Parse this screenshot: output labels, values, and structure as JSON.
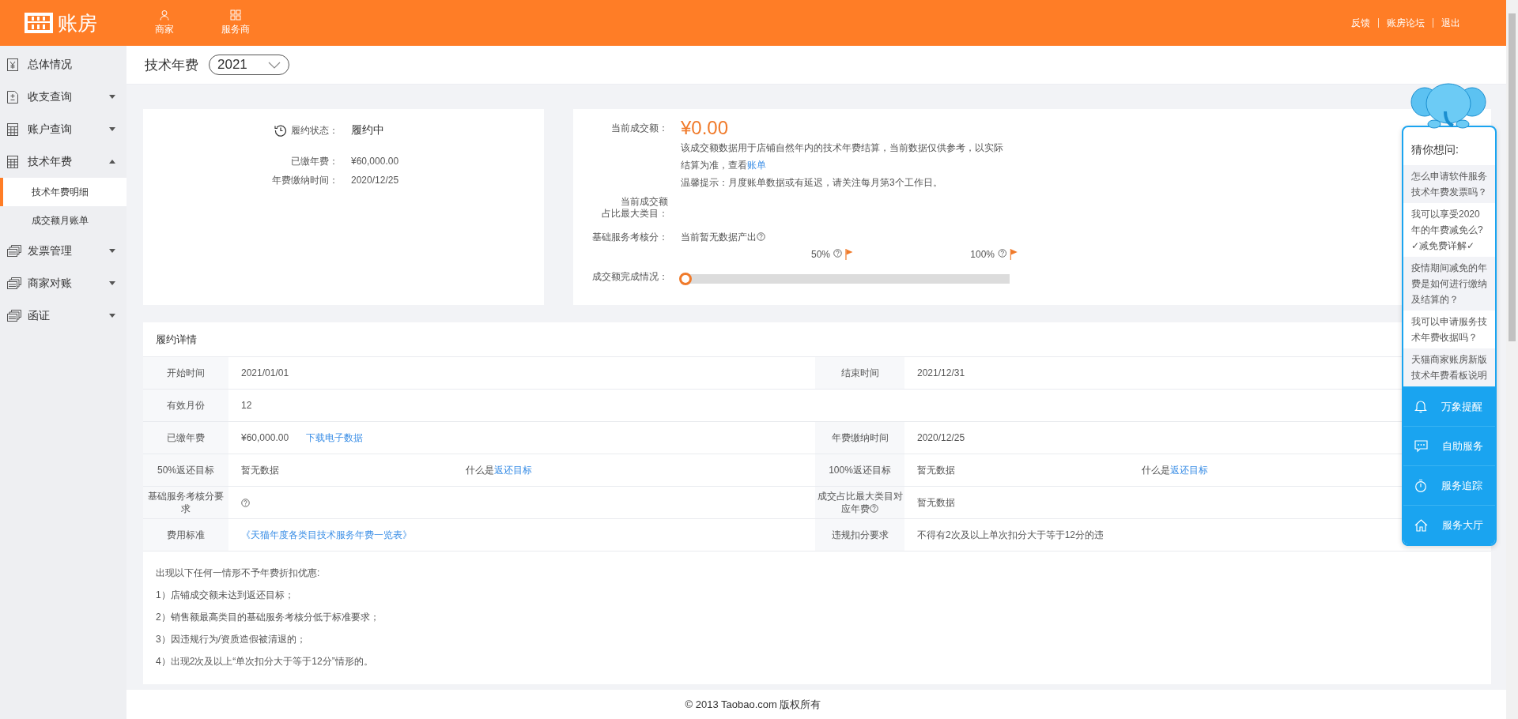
{
  "header": {
    "logo": "账房",
    "nav": [
      {
        "label": "商家"
      },
      {
        "label": "服务商"
      }
    ],
    "links": [
      "反馈",
      "账房论坛",
      "退出"
    ]
  },
  "sidebar": {
    "items": [
      {
        "label": "总体情况",
        "kind": "link"
      },
      {
        "label": "收支查询",
        "kind": "group",
        "expanded": false
      },
      {
        "label": "账户查询",
        "kind": "group",
        "expanded": false
      },
      {
        "label": "技术年费",
        "kind": "group",
        "expanded": true,
        "children": [
          {
            "label": "技术年费明细",
            "selected": true
          },
          {
            "label": "成交额月账单",
            "selected": false
          }
        ]
      },
      {
        "label": "发票管理",
        "kind": "group",
        "expanded": false
      },
      {
        "label": "商家对账",
        "kind": "group",
        "expanded": false
      },
      {
        "label": "函证",
        "kind": "group",
        "expanded": false
      }
    ]
  },
  "page": {
    "title": "技术年费",
    "year": "2021"
  },
  "status": {
    "label": "履约状态：",
    "value": "履约中",
    "rows": [
      {
        "label": "已缴年费：",
        "value": "¥60,000.00"
      },
      {
        "label": "年费缴纳时间：",
        "value": "2020/12/25"
      }
    ]
  },
  "sales": {
    "amount_label": "当前成交额：",
    "amount": "¥0.00",
    "note": "该成交额数据用于店铺自然年内的技术年费结算，当前数据仅供参考，以实际结算为准，查看",
    "note_link": "账单",
    "tip": "温馨提示：月度账单数据或有延迟，请关注每月第3个工作日。",
    "category_label": [
      "当前成交额",
      "占比最大类目："
    ],
    "score_label": "基础服务考核分：",
    "score_value": "当前暂无数据产出",
    "progress_label": "成交额完成情况：",
    "level": 0,
    "marks": [
      "50%",
      "100%"
    ]
  },
  "detail": {
    "title": "履约详情",
    "rows": [
      {
        "cells": [
          {
            "kind": "label",
            "text": "开始时间"
          },
          {
            "kind": "value",
            "text": "2021/01/01"
          },
          {
            "kind": "label",
            "text": "结束时间"
          },
          {
            "kind": "value",
            "text": "2021/12/31"
          }
        ]
      },
      {
        "cells": [
          {
            "kind": "label",
            "text": "有效月份"
          },
          {
            "kind": "value",
            "text": "12"
          }
        ]
      },
      {
        "cells": [
          {
            "kind": "label",
            "text": "已缴年费"
          },
          {
            "kind": "value",
            "text": "¥60,000.00",
            "link": "下载电子数据"
          },
          {
            "kind": "label",
            "text": "年费缴纳时间"
          },
          {
            "kind": "value",
            "text": "2020/12/25"
          }
        ]
      },
      {
        "cells": [
          {
            "kind": "label",
            "text": "50%返还目标"
          },
          {
            "kind": "value",
            "text": "暂无数据",
            "hint": "什么是",
            "hint_link": "返还目标"
          },
          {
            "kind": "label",
            "text": "100%返还目标"
          },
          {
            "kind": "value",
            "text": "暂无数据",
            "hint": "什么是",
            "hint_link": "返还目标"
          }
        ]
      },
      {
        "cells": [
          {
            "kind": "label",
            "text": "基础服务考核分要求"
          },
          {
            "kind": "help"
          },
          {
            "kind": "label_help",
            "text": "成交占比最大类目对应年费"
          },
          {
            "kind": "value",
            "text": "暂无数据"
          }
        ]
      },
      {
        "cells": [
          {
            "kind": "label",
            "text": "费用标准"
          },
          {
            "kind": "link",
            "text": "《天猫年度各类目技术服务年费一览表》"
          },
          {
            "kind": "label",
            "text": "违规扣分要求"
          },
          {
            "kind": "value",
            "text": "不得有2次及以上单次扣分大于等于12分的违"
          }
        ]
      }
    ],
    "notes": [
      "出现以下任何一情形不予年费折扣优惠:",
      "1）店铺成交额未达到返还目标；",
      "2）销售额最高类目的基础服务考核分低于标准要求；",
      "3）因违规行为/资质造假被清退的；",
      "4）出现2次及以上“单次扣分大于等于12分”情形的。"
    ]
  },
  "help": {
    "title": "猜你想问:",
    "questions": [
      "怎么申请软件服务技术年费发票吗？",
      "我可以享受2020年的年费减免么?✓减免费详解✓",
      "疫情期间减免的年费是如何进行缴纳及结算的？",
      "我可以申请服务技术年费收据吗？",
      "天猫商家账房新版技术年费看板说明"
    ],
    "actions": [
      "万象提醒",
      "自助服务",
      "服务追踪",
      "服务大厅"
    ]
  },
  "footer": "© 2013 Taobao.com 版权所有"
}
